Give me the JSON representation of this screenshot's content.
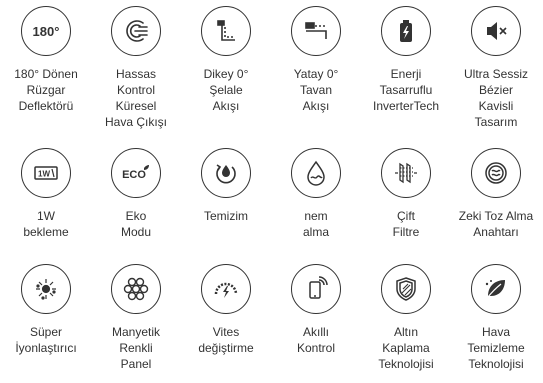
{
  "colors": {
    "icon_stroke": "#333333",
    "text": "#333333",
    "background": "#ffffff"
  },
  "features": [
    {
      "icon": "deflector-180-icon",
      "icon_text": "180°",
      "lines": [
        "180° Dönen",
        "Rüzgar",
        "Deflektörü"
      ]
    },
    {
      "icon": "airflow-swirl-icon",
      "lines": [
        "Hassas",
        "Kontrol",
        "Küresel",
        "Hava Çıkışı"
      ]
    },
    {
      "icon": "vertical-airflow-icon",
      "lines": [
        "Dikey 0°",
        "Şelale",
        "Akışı"
      ]
    },
    {
      "icon": "ceiling-airflow-icon",
      "lines": [
        "Yatay 0°",
        "Tavan",
        "Akışı"
      ]
    },
    {
      "icon": "battery-icon",
      "lines": [
        "Enerji",
        "Tasarruflu",
        "InverterTech"
      ]
    },
    {
      "icon": "mute-speaker-icon",
      "lines": [
        "Ultra Sessiz",
        "Bézier",
        "Kavisli",
        "Tasarım"
      ]
    },
    {
      "icon": "standby-1w-icon",
      "icon_text": "1W",
      "lines": [
        "1W",
        "bekleme"
      ]
    },
    {
      "icon": "eco-icon",
      "icon_text": "ECO",
      "lines": [
        "Eko",
        "Modu"
      ]
    },
    {
      "icon": "self-clean-icon",
      "lines": [
        "Temizim"
      ]
    },
    {
      "icon": "dehumidify-icon",
      "lines": [
        "nem",
        "alma"
      ]
    },
    {
      "icon": "double-filter-icon",
      "lines": [
        "Çift",
        "Filtre"
      ]
    },
    {
      "icon": "dust-switch-icon",
      "lines": [
        "Zeki Toz Alma",
        "Anahtarı"
      ]
    },
    {
      "icon": "ionizer-icon",
      "lines": [
        "Süper",
        "İyonlaştırıcı"
      ]
    },
    {
      "icon": "magnetic-panel-icon",
      "lines": [
        "Manyetik",
        "Renkli",
        "Panel"
      ]
    },
    {
      "icon": "speed-gauge-icon",
      "lines": [
        "Vites",
        "değiştirme"
      ]
    },
    {
      "icon": "smart-phone-icon",
      "lines": [
        "Akıllı",
        "Kontrol"
      ]
    },
    {
      "icon": "gold-shield-icon",
      "lines": [
        "Altın",
        "Kaplama",
        "Teknolojisi"
      ]
    },
    {
      "icon": "air-purify-icon",
      "lines": [
        "Hava",
        "Temizleme",
        "Teknolojisi"
      ]
    }
  ]
}
